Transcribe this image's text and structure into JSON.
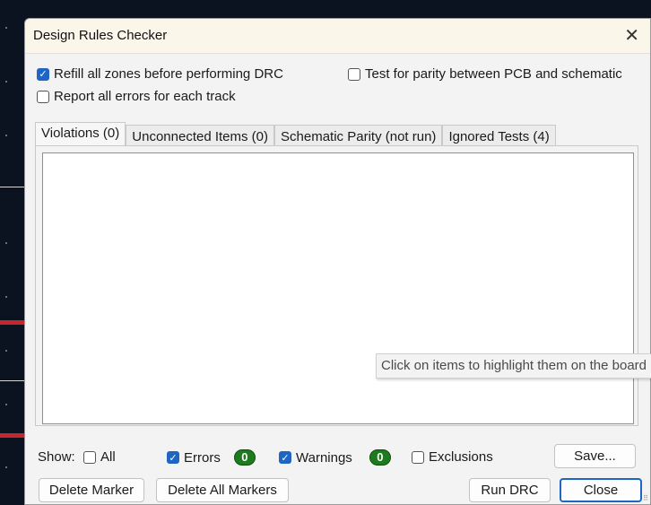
{
  "dialog": {
    "title": "Design Rules Checker"
  },
  "options": {
    "refill_zones": {
      "label": "Refill all zones before performing DRC",
      "checked": true
    },
    "report_all_errors": {
      "label": "Report all errors for each track",
      "checked": false
    },
    "test_parity": {
      "label": "Test for parity between PCB and schematic",
      "checked": false
    }
  },
  "tabs": [
    {
      "label": "Violations (0)",
      "active": true
    },
    {
      "label": "Unconnected Items (0)",
      "active": false
    },
    {
      "label": "Schematic Parity (not run)",
      "active": false
    },
    {
      "label": "Ignored Tests (4)",
      "active": false
    }
  ],
  "tooltip": "Click on items to highlight them on the board",
  "filters": {
    "show_label": "Show:",
    "all": {
      "label": "All",
      "checked": false
    },
    "errors": {
      "label": "Errors",
      "checked": true,
      "count": "0"
    },
    "warnings": {
      "label": "Warnings",
      "checked": true,
      "count": "0"
    },
    "exclusions": {
      "label": "Exclusions",
      "checked": false
    }
  },
  "buttons": {
    "save": "Save...",
    "delete_marker": "Delete Marker",
    "delete_all_markers": "Delete All Markers",
    "run_drc": "Run DRC",
    "close": "Close"
  },
  "colors": {
    "checkbox_accent": "#1f66c4",
    "count_badge": "#1e7a1e",
    "tooltip_bg": "#f3f3f3"
  }
}
